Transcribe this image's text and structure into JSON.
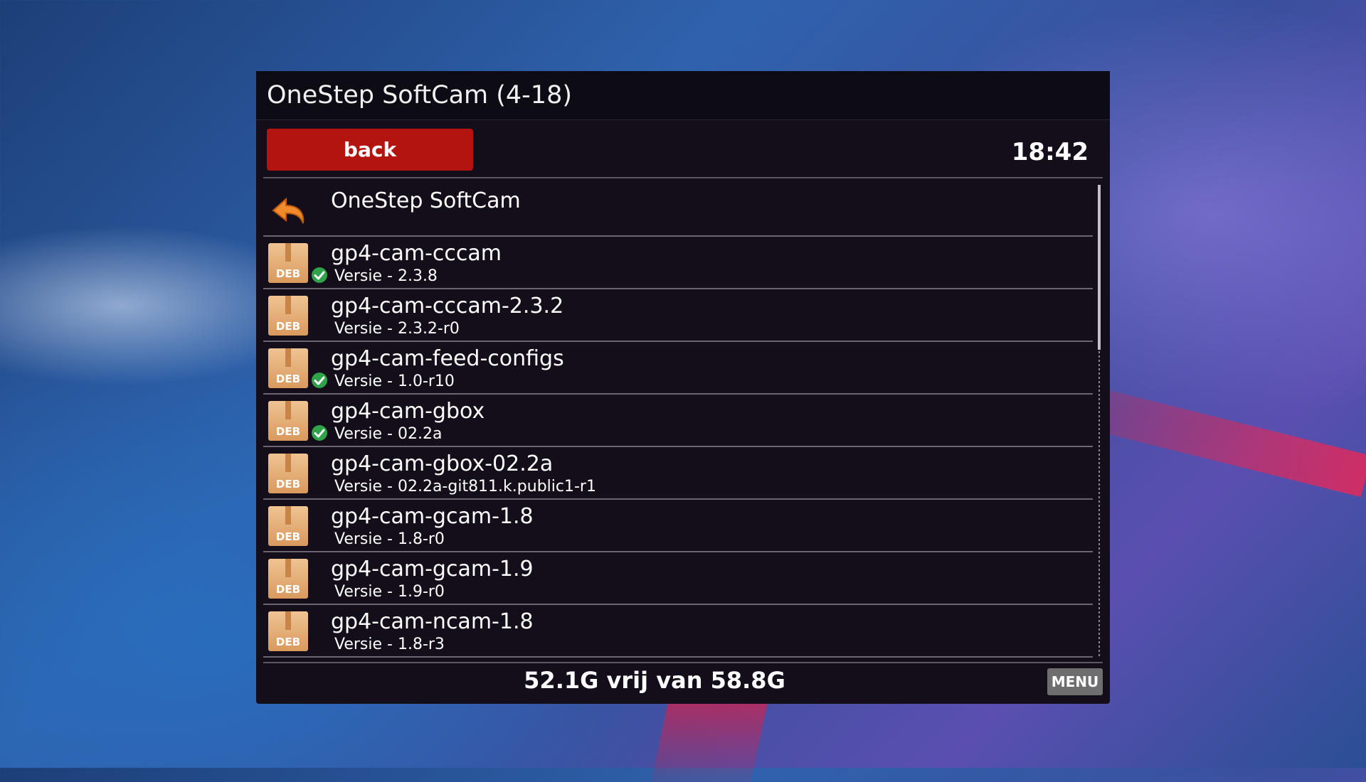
{
  "window": {
    "title": "OneStep SoftCam (4-18)",
    "back_label": "back",
    "clock": "18:42",
    "status": "52.1G vrij van 58.8G",
    "menu_label": "MENU"
  },
  "list": {
    "parent": {
      "name": "OneStep SoftCam",
      "icon": "back-arrow-icon"
    },
    "items": [
      {
        "name": "gp4-cam-cccam",
        "version": "Versie - 2.3.8",
        "installed": true,
        "icon": "deb-package-icon",
        "icon_label": "DEB"
      },
      {
        "name": "gp4-cam-cccam-2.3.2",
        "version": "Versie - 2.3.2-r0",
        "installed": false,
        "icon": "deb-package-icon",
        "icon_label": "DEB"
      },
      {
        "name": "gp4-cam-feed-configs",
        "version": "Versie - 1.0-r10",
        "installed": true,
        "icon": "deb-package-icon",
        "icon_label": "DEB"
      },
      {
        "name": "gp4-cam-gbox",
        "version": "Versie - 02.2a",
        "installed": true,
        "icon": "deb-package-icon",
        "icon_label": "DEB"
      },
      {
        "name": "gp4-cam-gbox-02.2a",
        "version": "Versie - 02.2a-git811.k.public1-r1",
        "installed": false,
        "icon": "deb-package-icon",
        "icon_label": "DEB"
      },
      {
        "name": "gp4-cam-gcam-1.8",
        "version": "Versie - 1.8-r0",
        "installed": false,
        "icon": "deb-package-icon",
        "icon_label": "DEB"
      },
      {
        "name": "gp4-cam-gcam-1.9",
        "version": "Versie - 1.9-r0",
        "installed": false,
        "icon": "deb-package-icon",
        "icon_label": "DEB"
      },
      {
        "name": "gp4-cam-ncam-1.8",
        "version": "Versie - 1.8-r3",
        "installed": false,
        "icon": "deb-package-icon",
        "icon_label": "DEB"
      }
    ]
  },
  "colors": {
    "back_button": "#b4140f",
    "installed_check": "#2fa24a",
    "deb_icon": "#e0a86a",
    "panel_bg": "#140d1a"
  }
}
